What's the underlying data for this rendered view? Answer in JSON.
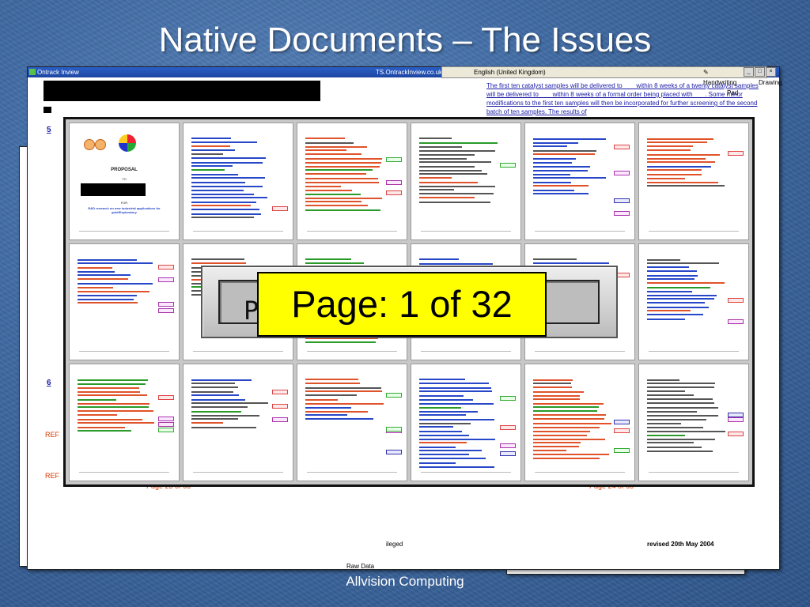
{
  "slide": {
    "title": "Native Documents – The Issues",
    "footer": "Allvision Computing"
  },
  "window": {
    "app_title": "Ontrack Inview",
    "server": "TS.OntrackInview.co.uk",
    "language": "English (United Kingdom)",
    "handwriting": "Handwriting",
    "drawing_pad": "Drawing Pad"
  },
  "document": {
    "section_5": "5",
    "section_6": "6",
    "intro_text": "The first ten catalyst samples will be delivered to ___ within 8 weeks of a twenty catalyst samples will be delivered to ___ within 8 weeks of a formal order being placed with ___. Some minor modifications to the first ten samples will then be incorporated for further screening of the second batch of ten samples. The results of",
    "privileged": "ileged",
    "revised": "revised 20th May 2004",
    "raw_data": "Raw Data",
    "ref1": "REF",
    "ref2": "REF",
    "page_left": "Page 23 of 63",
    "page_right": "Page 24 of 63"
  },
  "thumbnails": {
    "proposal_title": "PROPOSAL",
    "proposal_to": "TO",
    "proposal_for": "FOR",
    "proposal_rd": "R&D research on new industrial applications for gold/Exploratory"
  },
  "counter": {
    "small_label": "Pag",
    "big_label": "Page: 1 of 32",
    "current_page": 1,
    "total_pages": 32
  },
  "colors": {
    "background": "#3f6aa3",
    "counter_highlight": "#ffff00",
    "markup_red": "#d63a00",
    "markup_blue": "#1a1aa8"
  },
  "icons": [
    "app-icon",
    "minimize-icon",
    "maximize-icon",
    "close-icon",
    "pen-icon",
    "drawing-pad-icon"
  ]
}
